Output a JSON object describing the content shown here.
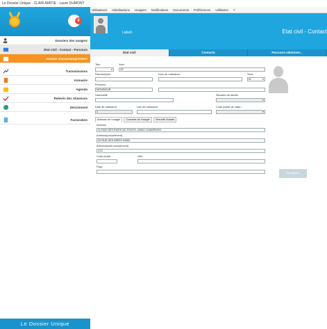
{
  "window": {
    "title": "Le Dossier Unique - CLAIR AMITIE - Laure DUMONT"
  },
  "menu": [
    "Utilisateurs",
    "Initialisations",
    "Usagers",
    "Notifications",
    "Documents",
    "Préférences",
    "Utilitaires",
    "?"
  ],
  "sidebar": {
    "notification_count": "0",
    "items": [
      {
        "label": "Dossiers des usagers"
      },
      {
        "label": "Etat civil - Contact - Parcours"
      },
      {
        "label": "Dossier d'accompagnement"
      },
      {
        "label": "Transmissions"
      },
      {
        "label": "Annuaire"
      },
      {
        "label": "Agenda"
      },
      {
        "label": "Relevés des Absences"
      },
      {
        "label": "Décisionnel"
      },
      {
        "label": "Facturation"
      }
    ],
    "footer": "Le Dossier Unique"
  },
  "header": {
    "label": "Label1",
    "title": "Etat civil - Contact"
  },
  "tabs": [
    "Etat civil",
    "Contacts",
    "Parcours administr..."
  ],
  "form": {
    "titre_label": "Titre",
    "nom_label": "Nom",
    "nom_value": "ZZ",
    "pseudonyme_label": "Pseudonyme",
    "nom_naissance_label": "Nom de naissance",
    "sexe_label": "Sexe",
    "sexe_value": "M",
    "prenoms_label": "Prénoms",
    "prenoms_value": "MONSIEUR",
    "nationalite_label": "Nationalité",
    "situation_label": "Situation de famille",
    "date_naissance_label": "Date de naissance",
    "date_naissance_value": "1",
    "lieu_naissance_label": "Lieu de naissance",
    "code_postal_naissance_label": "Code postal de naiss...",
    "subtabs": [
      "Adresse de l'usager",
      "Contacts de l'usager",
      "Sécurité Sociale"
    ],
    "adresse_label": "Adresse",
    "adresse_value": "11 RUE DES RIVES DE PONTS, 94500 CHAMPIGNY",
    "adresse_comp_label": "Adresse(complément)",
    "adresse_comp_value": "25 RUE DES BIRES 94500",
    "adresse_suite_label": "Adresse(suite complément)",
    "adresse_suite_value": "C12",
    "code_postal_label": "Code postal",
    "ville_label": "Ville",
    "pays_label": "Pays",
    "save_label": "Enregistrer"
  }
}
